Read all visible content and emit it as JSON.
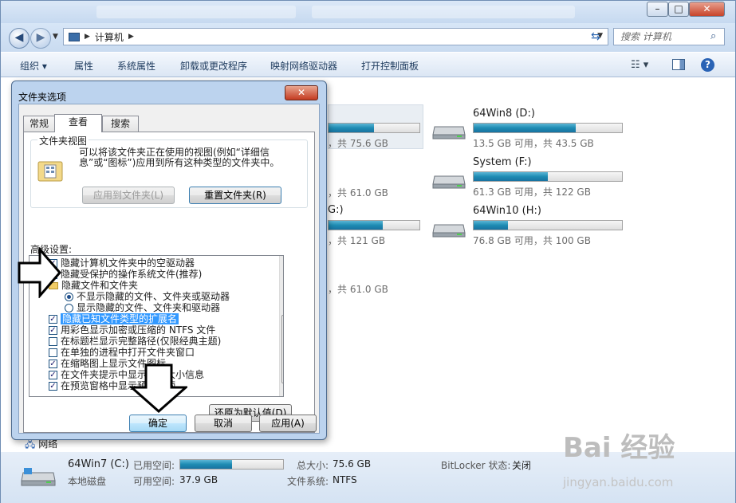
{
  "explorer": {
    "address_crumb": "计算机",
    "search_placeholder": "搜索 计算机",
    "toolbar": {
      "organize": "组织",
      "properties": "属性",
      "system_properties": "系统属性",
      "uninstall": "卸载或更改程序",
      "map_drive": "映射网络驱动器",
      "control_panel": "打开控制面板"
    },
    "drives": [
      {
        "name": "64Win8  (D:)",
        "size": "13.5 GB 可用，共 43.5 GB",
        "fill": 0.69
      },
      {
        "name": "System (F:)",
        "size": "61.3 GB 可用，共 122 GB",
        "fill": 0.5
      },
      {
        "name": "64Win10 (H:)",
        "size": "76.8 GB 可用，共 100 GB",
        "fill": 0.23
      }
    ],
    "hidden_drives": [
      {
        "name": "",
        "size": "，共 75.6 GB",
        "fill": 0.5
      },
      {
        "name": "",
        "size": "，共 61.0 GB",
        "fill": 0
      },
      {
        "name": "G:)",
        "size": "，共 121 GB",
        "fill": 0.6
      },
      {
        "name": "",
        "size": "，共 61.0 GB",
        "fill": 0
      }
    ],
    "network_label": "网络",
    "details": {
      "name": "64Win7  (C:)",
      "type": "本地磁盘",
      "used_label": "已用空间:",
      "free_label": "可用空间:",
      "free_value": "37.9 GB",
      "total_label": "总大小:",
      "total_value": "75.6 GB",
      "fs_label": "文件系统:",
      "fs_value": "NTFS",
      "bitlocker_label": "BitLocker 状态:",
      "bitlocker_value": "关闭",
      "used_fill": 0.5
    }
  },
  "dialog": {
    "title": "文件夹选项",
    "tabs": [
      "常规",
      "查看",
      "搜索"
    ],
    "folder_views_label": "文件夹视图",
    "folder_views_text": "可以将该文件夹正在使用的视图(例如“详细信息”或“图标”)应用到所有这种类型的文件夹中。",
    "apply_to_folders": "应用到文件夹(L)",
    "reset_folders": "重置文件夹(R)",
    "advanced_label": "高级设置:",
    "settings": [
      {
        "label": "隐藏计算机文件夹中的空驱动器",
        "kind": "checkbox",
        "checked": true
      },
      {
        "label": "隐藏受保护的操作系统文件(推荐)",
        "kind": "checkbox",
        "checked": true
      },
      {
        "label": "隐藏文件和文件夹",
        "kind": "folder"
      },
      {
        "label": "不显示隐藏的文件、文件夹或驱动器",
        "kind": "radio",
        "checked": true
      },
      {
        "label": "显示隐藏的文件、文件夹和驱动器",
        "kind": "radio",
        "checked": false
      },
      {
        "label": "隐藏已知文件类型的扩展名",
        "kind": "checkbox",
        "checked": true,
        "selected": true
      },
      {
        "label": "用彩色显示加密或压缩的 NTFS 文件",
        "kind": "checkbox",
        "checked": true
      },
      {
        "label": "在标题栏显示完整路径(仅限经典主题)",
        "kind": "checkbox",
        "checked": false
      },
      {
        "label": "在单独的进程中打开文件夹窗口",
        "kind": "checkbox",
        "checked": false
      },
      {
        "label": "在缩略图上显示文件图标",
        "kind": "checkbox",
        "checked": true
      },
      {
        "label": "在文件夹提示中显示文件大小信息",
        "kind": "checkbox",
        "checked": true
      },
      {
        "label": "在预览窗格中显示预览句柄",
        "kind": "checkbox",
        "checked": true
      }
    ],
    "restore_defaults": "还原为默认值(D)",
    "ok": "确定",
    "cancel": "取消",
    "apply": "应用(A)"
  },
  "watermark": {
    "brand": "Bai 经验",
    "url": "jingyan.baidu.com"
  }
}
